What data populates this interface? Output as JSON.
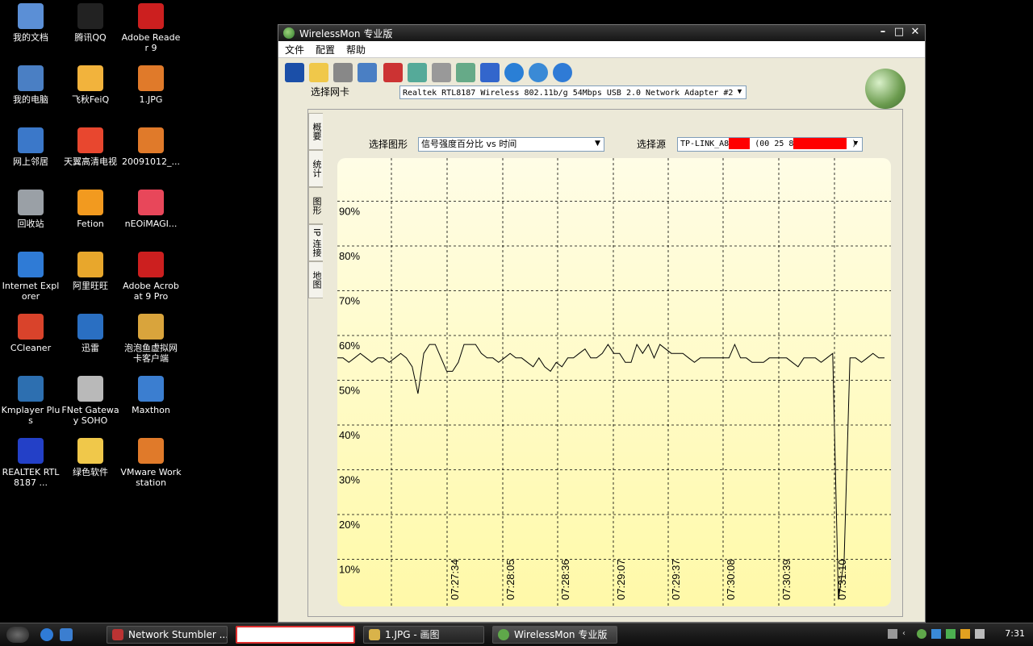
{
  "desktop": {
    "icons": [
      {
        "label": "我的文档",
        "icon": "documents-icon",
        "color": "#5b8fd6"
      },
      {
        "label": "腾讯QQ",
        "icon": "qq-penguin-icon",
        "color": "#222222"
      },
      {
        "label": "Adobe Reader 9",
        "icon": "adobe-reader-icon",
        "color": "#cc1f1f"
      },
      {
        "label": "我的电脑",
        "icon": "computer-icon",
        "color": "#4a7fc4"
      },
      {
        "label": "飞秋FeiQ",
        "icon": "feiq-icon",
        "color": "#f2b33c"
      },
      {
        "label": "1.JPG",
        "icon": "jpg-file-icon",
        "color": "#e07a2a"
      },
      {
        "label": "网上邻居",
        "icon": "network-places-icon",
        "color": "#3b78c9"
      },
      {
        "label": "天翼高清电视",
        "icon": "tv-app-icon",
        "color": "#e8472f"
      },
      {
        "label": "20091012_...",
        "icon": "image-file-icon",
        "color": "#e07a2a"
      },
      {
        "label": "回收站",
        "icon": "recycle-bin-icon",
        "color": "#9aa0a6"
      },
      {
        "label": "Fetion",
        "icon": "fetion-icon",
        "color": "#f29a1f"
      },
      {
        "label": "nEOiMAGI...",
        "icon": "neoimaging-icon",
        "color": "#e8475a"
      },
      {
        "label": "Internet Explorer",
        "icon": "ie-icon",
        "color": "#2f7bd6"
      },
      {
        "label": "阿里旺旺",
        "icon": "aliwangwang-icon",
        "color": "#e8a72c"
      },
      {
        "label": "Adobe Acrobat 9 Pro",
        "icon": "acrobat-icon",
        "color": "#cc1f1f"
      },
      {
        "label": "CCleaner",
        "icon": "ccleaner-icon",
        "color": "#d9432b"
      },
      {
        "label": "迅雷",
        "icon": "xunlei-icon",
        "color": "#2a6fc2"
      },
      {
        "label": "泡泡鱼虚拟网卡客户端",
        "icon": "fish-client-icon",
        "color": "#d9a43c"
      },
      {
        "label": "Kmplayer Plus",
        "icon": "kmplayer-icon",
        "color": "#2d6fb0"
      },
      {
        "label": "FNet Gateway SOHO",
        "icon": "fnet-gateway-icon",
        "color": "#b9b9b9"
      },
      {
        "label": "Maxthon",
        "icon": "maxthon-icon",
        "color": "#3b7ed0"
      },
      {
        "label": "REALTEK RTL8187 ...",
        "icon": "realtek-wifi-icon",
        "color": "#2340c7"
      },
      {
        "label": "绿色软件",
        "icon": "folder-icon",
        "color": "#f0c84a"
      },
      {
        "label": "VMware Workstation",
        "icon": "vmware-icon",
        "color": "#e07a2a"
      }
    ]
  },
  "window": {
    "title": "WirelessMon 专业版",
    "controls": {
      "minimize": "–",
      "maximize": "□",
      "close": "✕"
    },
    "menu": [
      "文件",
      "配置",
      "帮助"
    ],
    "toolbar_icons": [
      "save-icon",
      "open-folder-icon",
      "gauge-icon",
      "network-icon",
      "disconnect-icon",
      "connect-icon",
      "adapter-icon",
      "properties-icon",
      "checklist-icon",
      "globe-icon",
      "info-icon",
      "help-icon"
    ],
    "nic_label": "选择网卡",
    "nic_value": "Realtek RTL8187 Wireless 802.11b/g 54Mbps USB 2.0 Network Adapter #2",
    "tabs": [
      "概要",
      "统计",
      "图形",
      "IP 连接",
      "地图"
    ],
    "active_tab": "图形",
    "graph_label": "选择图形",
    "graph_value": "信号强度百分比 vs 时间",
    "source_label": "选择源",
    "source_value_prefix": "TP-LINK_A8",
    "source_value_mid": "(00 25 8",
    "source_value_suffix": ")"
  },
  "chart_data": {
    "type": "line",
    "title": "",
    "ylabel": "",
    "xlabel": "",
    "y_ticks": [
      "90%",
      "80%",
      "70%",
      "60%",
      "50%",
      "40%",
      "30%",
      "20%",
      "10%"
    ],
    "y_values": [
      90,
      80,
      70,
      60,
      50,
      40,
      30,
      20,
      10
    ],
    "ylim": [
      0,
      100
    ],
    "x_ticks": [
      "07:27:34",
      "07:28:05",
      "07:28:36",
      "07:29:07",
      "07:29:37",
      "07:30:08",
      "07:30:39",
      "07:31:10"
    ],
    "grid": true,
    "series": [
      {
        "values": [
          55,
          55,
          54,
          55,
          56,
          55,
          54,
          55,
          55,
          54,
          55,
          56,
          55,
          53,
          47,
          56,
          58,
          58,
          55,
          52,
          52,
          54,
          58,
          58,
          58,
          56,
          55,
          55,
          54,
          55,
          56,
          55,
          55,
          54,
          53,
          55,
          53,
          52,
          54,
          53,
          55,
          55,
          56,
          57,
          55,
          55,
          56,
          58,
          56,
          56,
          54,
          54,
          58,
          56,
          58,
          55,
          58,
          57,
          56,
          56,
          56,
          55,
          54,
          55,
          55,
          55,
          55,
          55,
          55,
          58,
          55,
          55,
          54,
          54,
          54,
          55,
          55,
          55,
          55,
          54,
          53,
          55,
          55,
          55,
          54,
          55,
          56,
          1,
          10,
          55,
          55,
          54,
          55,
          56,
          55,
          55
        ]
      }
    ]
  },
  "taskbar": {
    "buttons": [
      {
        "label": "Network Stumbler ...",
        "icon": "netstumbler-icon"
      },
      {
        "label": "",
        "icon": ""
      },
      {
        "label": "1.JPG - 画图",
        "icon": "paint-icon"
      },
      {
        "label": "WirelessMon 专业版",
        "icon": "wirelessmon-icon"
      }
    ],
    "time": "7:31"
  }
}
